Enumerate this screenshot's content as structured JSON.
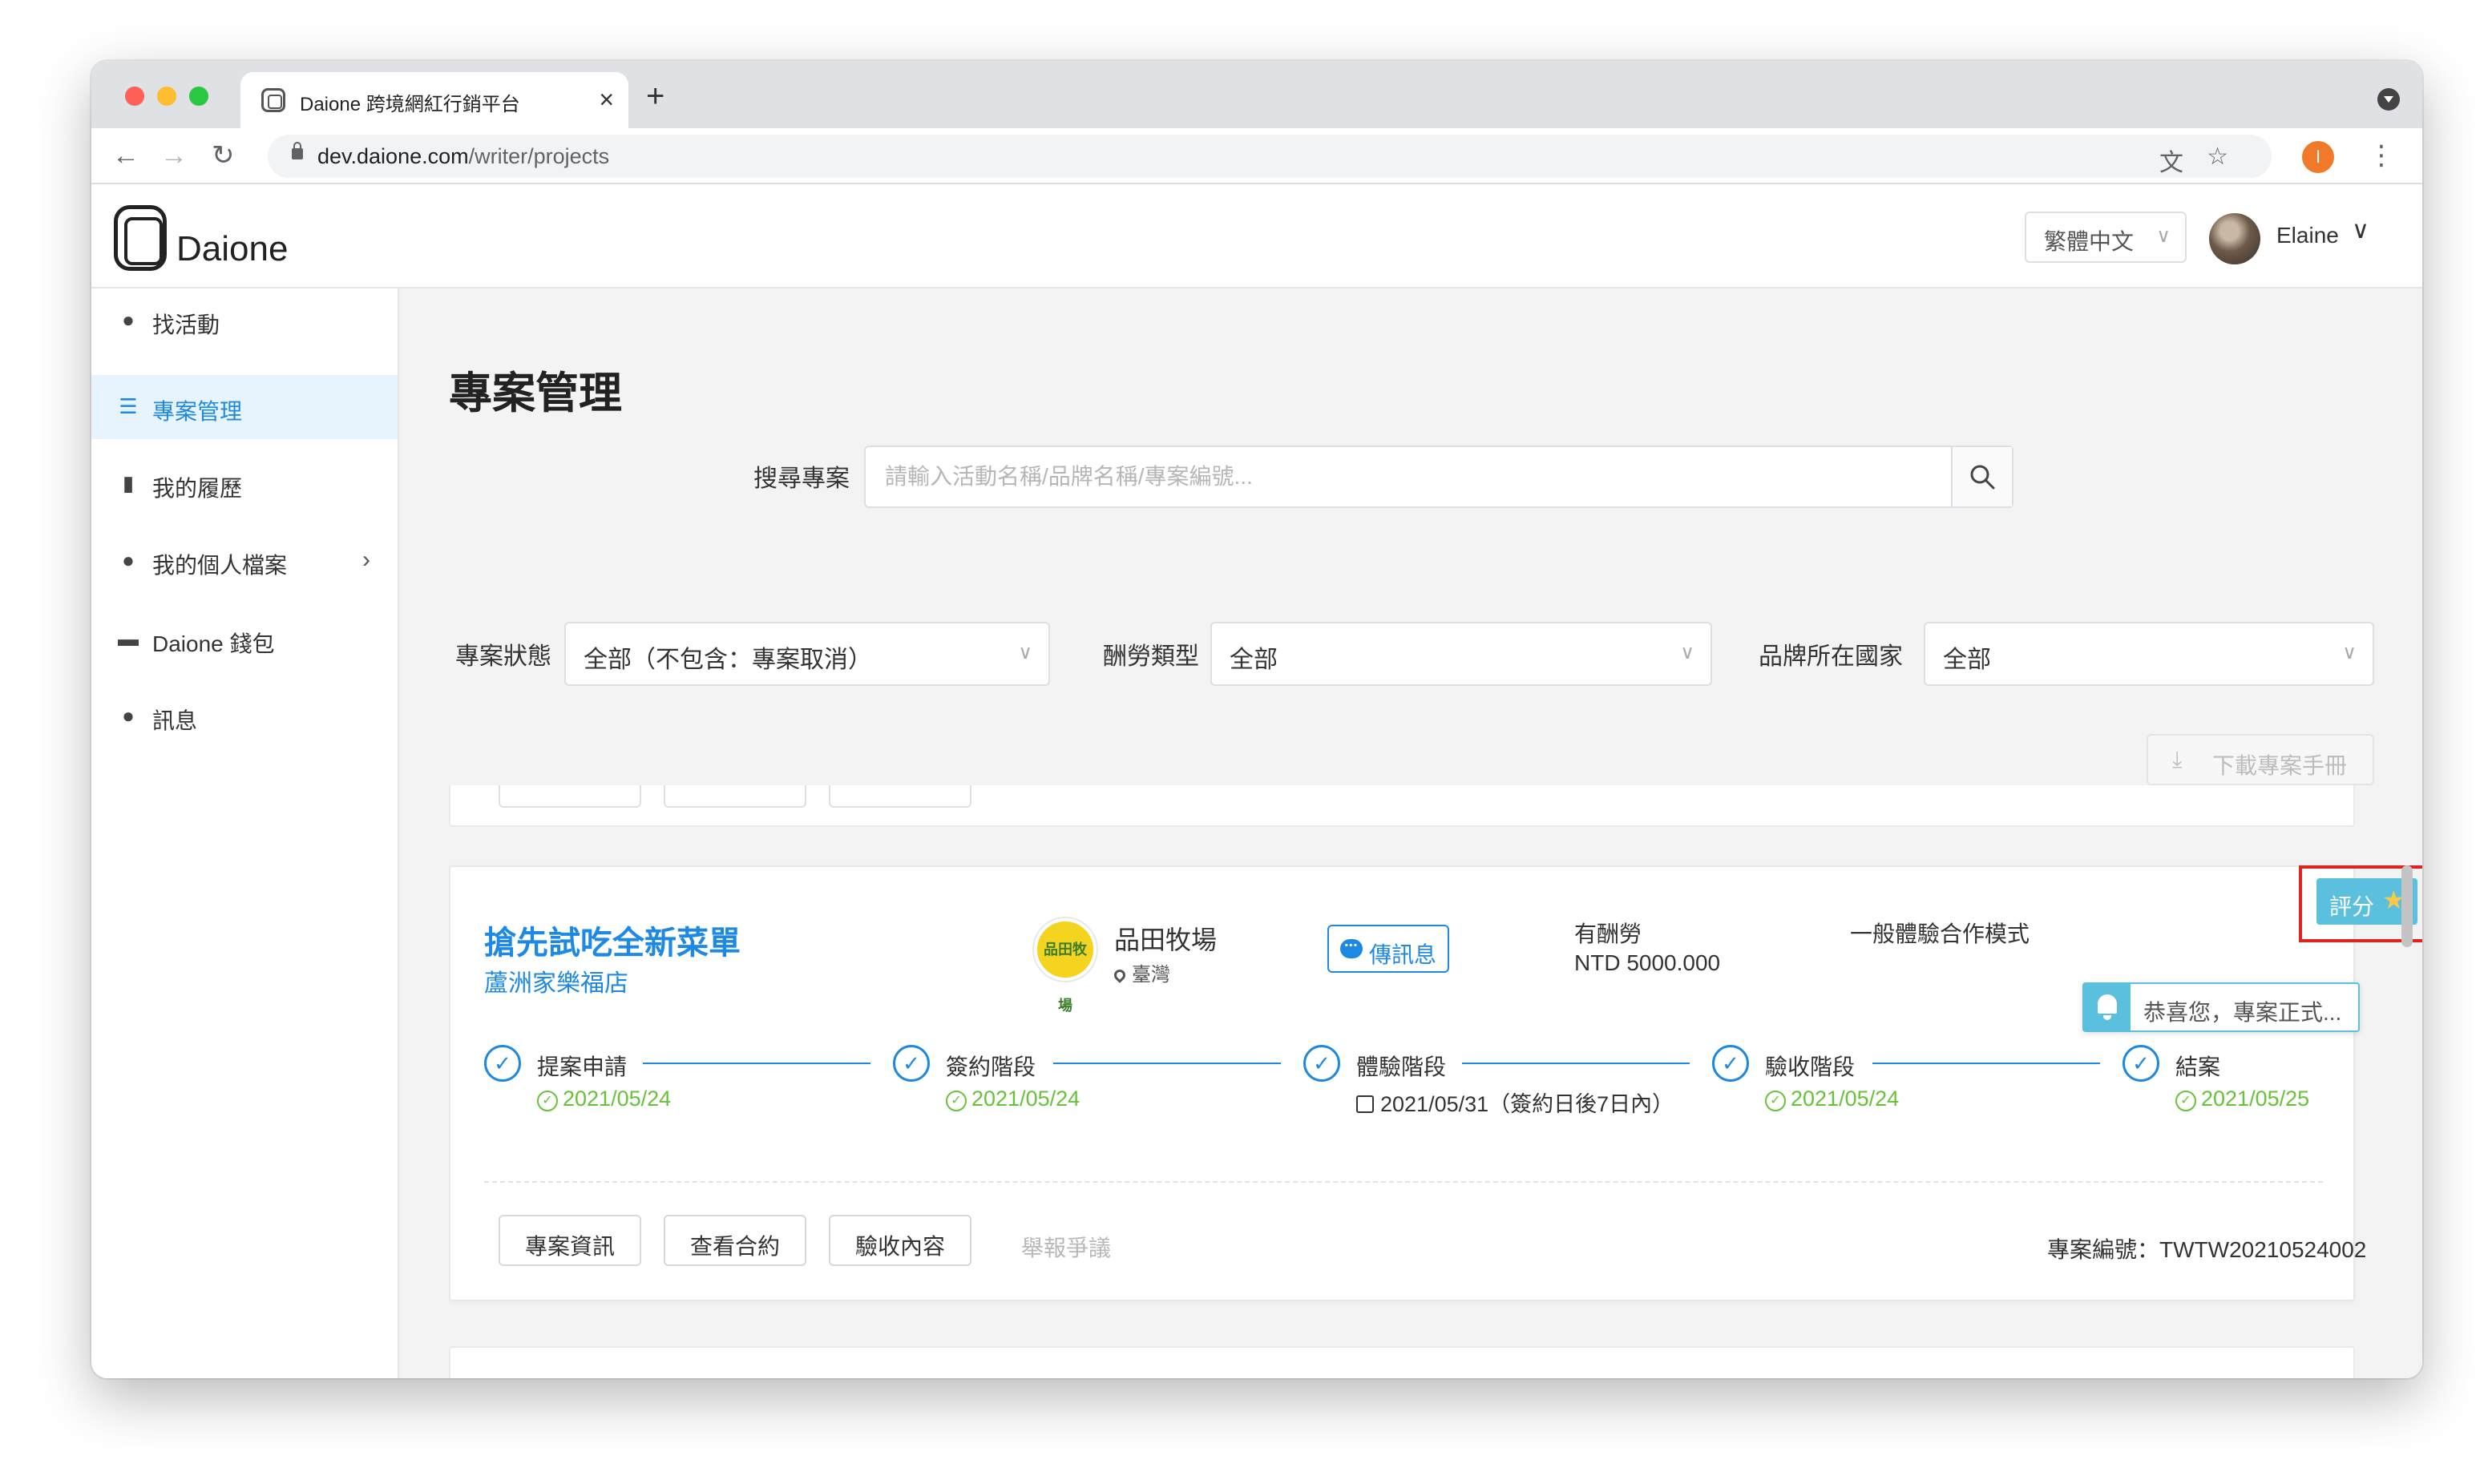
{
  "browser": {
    "tab_title": "Daione 跨境網紅行銷平台",
    "tab_close": "×",
    "new_tab": "+",
    "url_host": "dev.daione.com",
    "url_path": "/writer/projects",
    "back": "←",
    "forward": "→",
    "reload": "↻",
    "translate_icon": "文",
    "star": "☆",
    "profile_initial": "I",
    "menu": "⋮"
  },
  "header": {
    "logo_text": "Daione",
    "language": "繁體中文",
    "language_caret": "∨",
    "user_name": "Elaine",
    "user_caret": "∨"
  },
  "sidebar": {
    "items": [
      {
        "label": "找活動",
        "icon": "lightbulb-icon",
        "glyph": "●"
      },
      {
        "label": "專案管理",
        "icon": "list-icon",
        "glyph": "☰",
        "active": true
      },
      {
        "label": "我的履歷",
        "icon": "document-icon",
        "glyph": "▮"
      },
      {
        "label": "我的個人檔案",
        "icon": "user-icon",
        "glyph": "●",
        "arrow": "›"
      },
      {
        "label": "Daione 錢包",
        "icon": "wallet-icon",
        "glyph": "▬"
      },
      {
        "label": "訊息",
        "icon": "chat-icon",
        "glyph": "●"
      }
    ]
  },
  "main": {
    "title": "專案管理",
    "search": {
      "label": "搜尋專案",
      "placeholder": "請輸入活動名稱/品牌名稱/專案編號..."
    },
    "filters": {
      "status": {
        "label": "專案狀態",
        "value": "全部（不包含：專案取消）"
      },
      "pay_type": {
        "label": "酬勞類型",
        "value": "全部"
      },
      "country": {
        "label": "品牌所在國家",
        "value": "全部"
      },
      "caret": "∨"
    },
    "download": {
      "icon": "⤓",
      "label": "下載專案手冊"
    }
  },
  "project": {
    "title": "搶先試吃全新菜單",
    "subtitle": "蘆洲家樂福店",
    "brand": {
      "name": "品田牧場",
      "location": "臺灣",
      "logo_text": "品田牧場"
    },
    "message_button": "傳訊息",
    "pay_type": "有酬勞",
    "pay_amount": "NTD 5000.000",
    "coop_mode": "一般體驗合作模式",
    "rate_button": "評分",
    "rate_star": "★",
    "check": "✓",
    "steps": [
      {
        "name": "提案申請",
        "date": "2021/05/24",
        "done": true
      },
      {
        "name": "簽約階段",
        "date": "2021/05/24",
        "done": true
      },
      {
        "name": "體驗階段",
        "date": "2021/05/31（簽約日後7日內）",
        "done": false
      },
      {
        "name": "驗收階段",
        "date": "2021/05/24",
        "done": true
      },
      {
        "name": "結案",
        "date": "2021/05/25",
        "done": true
      }
    ],
    "actions": {
      "info": "專案資訊",
      "contract": "查看合約",
      "acceptance": "驗收內容",
      "dispute": "舉報爭議"
    },
    "project_number_label": "專案編號：",
    "project_number": "TWTW20210524002"
  },
  "toast": {
    "text": "恭喜您，專案正式..."
  },
  "colors": {
    "accent": "#1e88e5",
    "success": "#67c23a",
    "rate": "#5bc0de",
    "highlight": "#e0231c"
  }
}
